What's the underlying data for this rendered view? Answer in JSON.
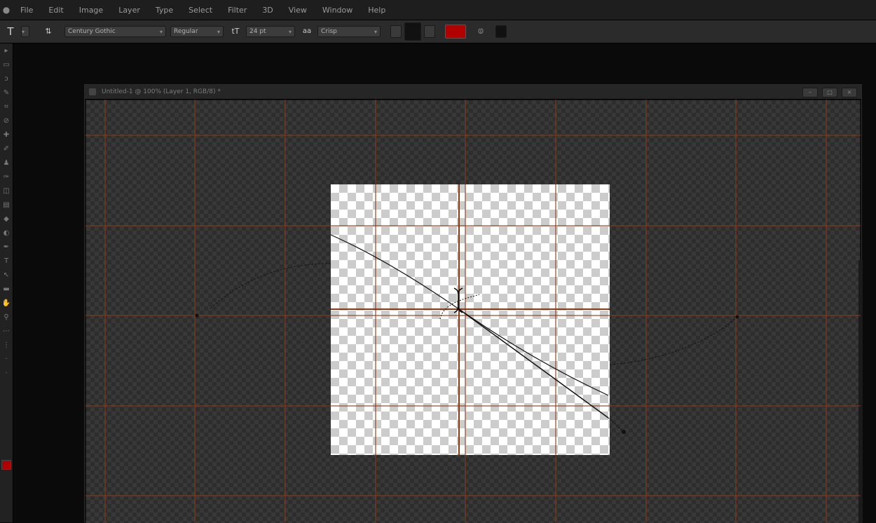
{
  "menu": {
    "app_icon": "apple-logo-icon",
    "items": [
      "File",
      "Edit",
      "Image",
      "Layer",
      "Type",
      "Select",
      "Filter",
      "3D",
      "View",
      "Window",
      "Help"
    ]
  },
  "options": {
    "tool_icon": "type-tool-icon",
    "font_family": "Century Gothic",
    "font_style": "Regular",
    "font_size": "24 pt",
    "antialias": "Crisp",
    "text_color": "#b00000"
  },
  "document": {
    "title": "Untitled-1 @ 100% (Layer 1, RGB/8) *"
  },
  "colors": {
    "guide": "#8b3a0f",
    "path": "#111111",
    "accent_red": "#b00000"
  }
}
